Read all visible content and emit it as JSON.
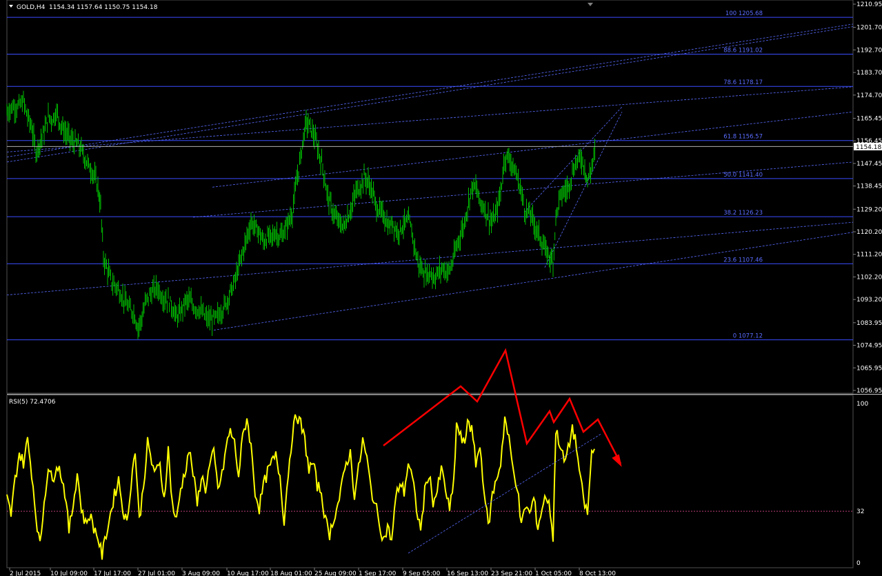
{
  "header": {
    "symbol": "GOLD,H4",
    "quote": "1154.34 1157.64 1150.75 1154.18"
  },
  "price_panel": {
    "current_price": "1154.18",
    "y_ticks": [
      "1210.95",
      "1201.70",
      "1192.70",
      "1183.70",
      "1174.70",
      "1165.45",
      "1156.45",
      "1147.45",
      "1138.45",
      "1129.20",
      "1120.20",
      "1111.20",
      "1102.20",
      "1093.20",
      "1083.95",
      "1074.95",
      "1065.95",
      "1056.95"
    ]
  },
  "rsi_panel": {
    "title": "RSI(5) 72.4706",
    "levels": [
      "100",
      "32",
      "0"
    ]
  },
  "x_labels": [
    "2 Jul 2015",
    "10 Jul 09:00",
    "17 Jul 17:00",
    "27 Jul 01:00",
    "3 Aug 09:00",
    "10 Aug 17:00",
    "18 Aug 01:00",
    "25 Aug 09:00",
    "1 Sep 17:00",
    "9 Sep 05:00",
    "16 Sep 13:00",
    "23 Sep 21:00",
    "1 Oct 05:00",
    "8 Oct 13:00"
  ],
  "fibo_labels": [
    "100 1205.68",
    "88.6 1191.02",
    "78.6 1178.17",
    "61.8 1156.57",
    "50.0 1141.40",
    "38.2 1126.23",
    "23.6 1107.46",
    "0 1077.12"
  ],
  "chart_data": [
    {
      "type": "line",
      "title": "GOLD,H4",
      "description_series": "close price path (approximate)",
      "ylim": [
        1052,
        1213
      ],
      "fibonacci_levels": [
        {
          "level": 100,
          "price": 1205.68
        },
        {
          "level": 88.6,
          "price": 1191.02
        },
        {
          "level": 78.6,
          "price": 1178.17
        },
        {
          "level": 61.8,
          "price": 1156.57
        },
        {
          "level": 50.0,
          "price": 1141.4
        },
        {
          "level": 38.2,
          "price": 1126.23
        },
        {
          "level": 23.6,
          "price": 1107.46
        },
        {
          "level": 0,
          "price": 1077.12
        }
      ],
      "price_path": [
        [
          0,
          1168
        ],
        [
          8,
          1170
        ],
        [
          16,
          1170
        ],
        [
          24,
          1172
        ],
        [
          30,
          1166
        ],
        [
          36,
          1162
        ],
        [
          42,
          1152
        ],
        [
          48,
          1156
        ],
        [
          54,
          1160
        ],
        [
          60,
          1166
        ],
        [
          66,
          1165
        ],
        [
          72,
          1168
        ],
        [
          78,
          1163
        ],
        [
          84,
          1160
        ],
        [
          90,
          1158
        ],
        [
          96,
          1156
        ],
        [
          102,
          1155
        ],
        [
          108,
          1153
        ],
        [
          114,
          1149
        ],
        [
          120,
          1146
        ],
        [
          126,
          1143
        ],
        [
          132,
          1138
        ],
        [
          136,
          1130
        ],
        [
          140,
          1110
        ],
        [
          146,
          1105
        ],
        [
          152,
          1100
        ],
        [
          160,
          1098
        ],
        [
          168,
          1094
        ],
        [
          176,
          1090
        ],
        [
          184,
          1088
        ],
        [
          190,
          1082
        ],
        [
          196,
          1086
        ],
        [
          202,
          1093
        ],
        [
          210,
          1096
        ],
        [
          218,
          1098
        ],
        [
          226,
          1094
        ],
        [
          234,
          1093
        ],
        [
          240,
          1090
        ],
        [
          246,
          1086
        ],
        [
          252,
          1088
        ],
        [
          258,
          1092
        ],
        [
          264,
          1093
        ],
        [
          272,
          1090
        ],
        [
          280,
          1089
        ],
        [
          288,
          1086
        ],
        [
          296,
          1085
        ],
        [
          304,
          1086
        ],
        [
          312,
          1089
        ],
        [
          318,
          1092
        ],
        [
          324,
          1096
        ],
        [
          330,
          1100
        ],
        [
          336,
          1106
        ],
        [
          342,
          1112
        ],
        [
          348,
          1118
        ],
        [
          354,
          1124
        ],
        [
          360,
          1122
        ],
        [
          366,
          1120
        ],
        [
          372,
          1116
        ],
        [
          378,
          1118
        ],
        [
          384,
          1118
        ],
        [
          390,
          1120
        ],
        [
          396,
          1118
        ],
        [
          402,
          1120
        ],
        [
          408,
          1124
        ],
        [
          414,
          1128
        ],
        [
          420,
          1140
        ],
        [
          426,
          1150
        ],
        [
          430,
          1158
        ],
        [
          434,
          1164
        ],
        [
          440,
          1162
        ],
        [
          446,
          1158
        ],
        [
          452,
          1152
        ],
        [
          458,
          1146
        ],
        [
          464,
          1136
        ],
        [
          470,
          1130
        ],
        [
          476,
          1126
        ],
        [
          482,
          1124
        ],
        [
          488,
          1122
        ],
        [
          494,
          1126
        ],
        [
          500,
          1130
        ],
        [
          506,
          1136
        ],
        [
          512,
          1138
        ],
        [
          518,
          1142
        ],
        [
          524,
          1140
        ],
        [
          530,
          1136
        ],
        [
          536,
          1130
        ],
        [
          542,
          1128
        ],
        [
          548,
          1126
        ],
        [
          554,
          1122
        ],
        [
          560,
          1124
        ],
        [
          566,
          1120
        ],
        [
          572,
          1122
        ],
        [
          578,
          1124
        ],
        [
          584,
          1124
        ],
        [
          590,
          1116
        ],
        [
          596,
          1108
        ],
        [
          602,
          1105
        ],
        [
          608,
          1103
        ],
        [
          614,
          1104
        ],
        [
          620,
          1102
        ],
        [
          626,
          1104
        ],
        [
          632,
          1106
        ],
        [
          638,
          1104
        ],
        [
          644,
          1106
        ],
        [
          650,
          1112
        ],
        [
          656,
          1118
        ],
        [
          662,
          1122
        ],
        [
          668,
          1130
        ],
        [
          674,
          1138
        ],
        [
          680,
          1138
        ],
        [
          686,
          1132
        ],
        [
          692,
          1130
        ],
        [
          698,
          1126
        ],
        [
          704,
          1124
        ],
        [
          710,
          1128
        ],
        [
          716,
          1136
        ],
        [
          722,
          1150
        ],
        [
          728,
          1150
        ],
        [
          734,
          1146
        ],
        [
          740,
          1142
        ],
        [
          746,
          1136
        ],
        [
          752,
          1128
        ],
        [
          758,
          1128
        ],
        [
          764,
          1124
        ],
        [
          770,
          1120
        ],
        [
          776,
          1116
        ],
        [
          782,
          1112
        ],
        [
          788,
          1110
        ],
        [
          792,
          1108
        ],
        [
          796,
          1126
        ],
        [
          802,
          1134
        ],
        [
          808,
          1136
        ],
        [
          814,
          1138
        ],
        [
          820,
          1144
        ],
        [
          826,
          1148
        ],
        [
          832,
          1150
        ],
        [
          838,
          1146
        ],
        [
          842,
          1140
        ],
        [
          848,
          1146
        ],
        [
          854,
          1154
        ]
      ]
    },
    {
      "type": "line",
      "title": "RSI(5) 72.4706",
      "ylim": [
        0,
        100
      ],
      "levels": [
        32,
        100
      ],
      "rsi_path": [
        [
          0,
          40
        ],
        [
          6,
          30
        ],
        [
          12,
          52
        ],
        [
          18,
          68
        ],
        [
          24,
          62
        ],
        [
          30,
          76
        ],
        [
          36,
          56
        ],
        [
          42,
          30
        ],
        [
          48,
          10
        ],
        [
          54,
          38
        ],
        [
          60,
          60
        ],
        [
          66,
          50
        ],
        [
          72,
          62
        ],
        [
          78,
          56
        ],
        [
          84,
          44
        ],
        [
          90,
          20
        ],
        [
          96,
          36
        ],
        [
          102,
          56
        ],
        [
          108,
          34
        ],
        [
          114,
          24
        ],
        [
          120,
          30
        ],
        [
          126,
          22
        ],
        [
          132,
          16
        ],
        [
          138,
          4
        ],
        [
          144,
          18
        ],
        [
          150,
          30
        ],
        [
          156,
          42
        ],
        [
          162,
          52
        ],
        [
          168,
          34
        ],
        [
          174,
          24
        ],
        [
          180,
          50
        ],
        [
          186,
          70
        ],
        [
          192,
          26
        ],
        [
          198,
          48
        ],
        [
          204,
          74
        ],
        [
          210,
          62
        ],
        [
          216,
          56
        ],
        [
          222,
          60
        ],
        [
          228,
          40
        ],
        [
          234,
          70
        ],
        [
          240,
          36
        ],
        [
          246,
          26
        ],
        [
          252,
          46
        ],
        [
          258,
          56
        ],
        [
          264,
          70
        ],
        [
          270,
          56
        ],
        [
          276,
          36
        ],
        [
          282,
          54
        ],
        [
          288,
          46
        ],
        [
          294,
          60
        ],
        [
          300,
          68
        ],
        [
          306,
          46
        ],
        [
          312,
          54
        ],
        [
          318,
          72
        ],
        [
          324,
          82
        ],
        [
          330,
          74
        ],
        [
          336,
          54
        ],
        [
          342,
          78
        ],
        [
          348,
          90
        ],
        [
          354,
          72
        ],
        [
          360,
          44
        ],
        [
          366,
          34
        ],
        [
          372,
          48
        ],
        [
          378,
          56
        ],
        [
          384,
          62
        ],
        [
          390,
          66
        ],
        [
          396,
          54
        ],
        [
          402,
          26
        ],
        [
          408,
          56
        ],
        [
          414,
          80
        ],
        [
          420,
          92
        ],
        [
          426,
          86
        ],
        [
          432,
          76
        ],
        [
          438,
          58
        ],
        [
          444,
          62
        ],
        [
          450,
          48
        ],
        [
          456,
          44
        ],
        [
          462,
          26
        ],
        [
          468,
          18
        ],
        [
          474,
          28
        ],
        [
          480,
          36
        ],
        [
          486,
          48
        ],
        [
          492,
          62
        ],
        [
          498,
          68
        ],
        [
          504,
          42
        ],
        [
          510,
          58
        ],
        [
          516,
          76
        ],
        [
          522,
          64
        ],
        [
          528,
          46
        ],
        [
          534,
          36
        ],
        [
          540,
          26
        ],
        [
          546,
          14
        ],
        [
          552,
          22
        ],
        [
          558,
          14
        ],
        [
          564,
          40
        ],
        [
          570,
          50
        ],
        [
          576,
          44
        ],
        [
          582,
          62
        ],
        [
          588,
          52
        ],
        [
          594,
          34
        ],
        [
          600,
          20
        ],
        [
          606,
          44
        ],
        [
          612,
          56
        ],
        [
          618,
          38
        ],
        [
          624,
          44
        ],
        [
          630,
          58
        ],
        [
          636,
          46
        ],
        [
          642,
          32
        ],
        [
          648,
          50
        ],
        [
          652,
          86
        ],
        [
          658,
          78
        ],
        [
          664,
          72
        ],
        [
          668,
          90
        ],
        [
          674,
          82
        ],
        [
          680,
          62
        ],
        [
          686,
          72
        ],
        [
          692,
          46
        ],
        [
          698,
          22
        ],
        [
          704,
          42
        ],
        [
          710,
          52
        ],
        [
          716,
          62
        ],
        [
          722,
          90
        ],
        [
          728,
          76
        ],
        [
          734,
          58
        ],
        [
          740,
          48
        ],
        [
          746,
          22
        ],
        [
          752,
          36
        ],
        [
          758,
          30
        ],
        [
          764,
          40
        ],
        [
          770,
          22
        ],
        [
          776,
          34
        ],
        [
          782,
          42
        ],
        [
          788,
          32
        ],
        [
          792,
          16
        ],
        [
          796,
          82
        ],
        [
          802,
          74
        ],
        [
          808,
          62
        ],
        [
          814,
          70
        ],
        [
          820,
          84
        ],
        [
          826,
          72
        ],
        [
          832,
          50
        ],
        [
          838,
          36
        ],
        [
          842,
          30
        ],
        [
          848,
          68
        ],
        [
          854,
          72
        ]
      ]
    }
  ],
  "colors": {
    "background": "#000000",
    "candles": "#00c000",
    "fibo": "#3a4dff",
    "trend": "#5a6cff",
    "rsi": "#ffff00",
    "arrow": "#ff0000",
    "level_32": "#c0407a",
    "axis_text": "#ffffff"
  }
}
